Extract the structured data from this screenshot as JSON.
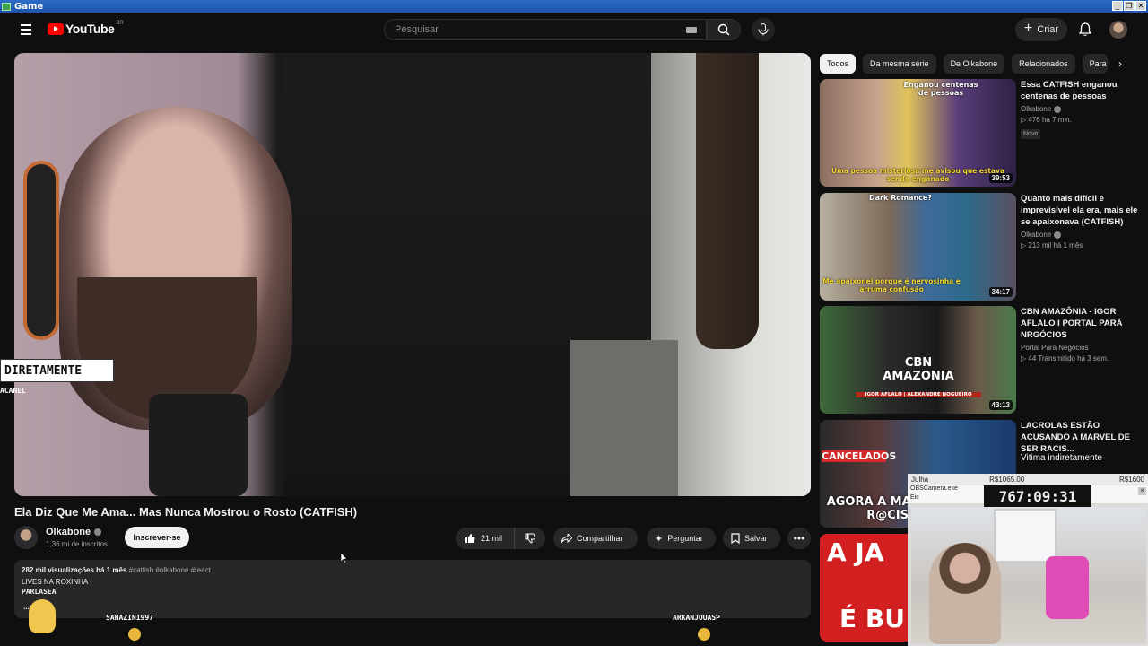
{
  "window": {
    "title": "Game",
    "controls": [
      "_",
      "❐",
      "✕"
    ]
  },
  "header": {
    "logo": "YouTube",
    "country": "BR",
    "search_placeholder": "Pesquisar",
    "create_label": "Criar"
  },
  "video": {
    "overlay_text": "DIRETAMENTE",
    "overlay_sub": "ACANEL",
    "title": "Ela Diz Que Me Ama... Mas Nunca Mostrou o Rosto (CATFISH)",
    "channel": "Olkabone",
    "subscribers": "1,36 mi de inscritos",
    "subscribe_label": "Inscrever-se",
    "likes": "21 mil",
    "share_label": "Compartilhar",
    "ask_label": "Perguntar",
    "save_label": "Salvar",
    "more_label": "•••"
  },
  "description": {
    "stats": "282 mil visualizações  há 1 mês",
    "tags": "#catfish #olkabone #react",
    "line1": "LIVES NA ROXINHA",
    "line2": "PARLASEA",
    "more": "...mais"
  },
  "chat": {
    "user1": "SAHAZIN1997",
    "user2": "ARKANJOUASP"
  },
  "chips": [
    "Todos",
    "Da mesma série",
    "De Olkabone",
    "Relacionados",
    "Para"
  ],
  "recommendations": [
    {
      "title": "Essa CATFISH enganou centenas de pessoas",
      "channel": "Olkabone",
      "stats": "▷ 476  há 7 min.",
      "badge": "Novo",
      "duration": "39:53",
      "thumb_top": "Enganou centenas de pessoas",
      "thumb_bottom": "Uma pessoa misteriosa me avisou que estava sendo enganado"
    },
    {
      "title": "Quanto mais difícil e imprevisível ela era, mais ele se apaixonava (CATFISH)",
      "channel": "Olkabone",
      "stats": "▷ 213 mil  há 1 mês",
      "duration": "34:17",
      "thumb_top": "Dark Romance?",
      "thumb_bottom": "Me apaixonei porque é nervosinha e arruma confusão"
    },
    {
      "title": "CBN AMAZÔNIA - IGOR AFLALO I PORTAL PARÁ NRGÓCIOS",
      "channel": "Portal Pará Negócios",
      "stats": "▷ 44  Transmitido há 3 sem.",
      "duration": "43:13",
      "thumb_top": "CBN AMAZONIA",
      "thumb_bottom": "IGOR AFLALO | ALEXANDRE NOGUEIRO"
    },
    {
      "title": "LACROLAS ESTÃO ACUSANDO A MARVEL DE SER RACIS...",
      "channel": "",
      "stats": "",
      "duration": "",
      "thumb_top": "CANCELADOS",
      "thumb_bottom": "AGORA A MARVEL É R@CIST"
    }
  ],
  "last_thumb": {
    "text1": "A JA",
    "text2": "É BU"
  },
  "overlay_widget": {
    "name": "Julha",
    "amount1": "R$1065.00",
    "amount2": "R$1600",
    "camera_label": "OBSCamera.exe",
    "camera_sub": "Eic",
    "timer": "767:09:31",
    "caption": "Vitima indiretamente"
  }
}
